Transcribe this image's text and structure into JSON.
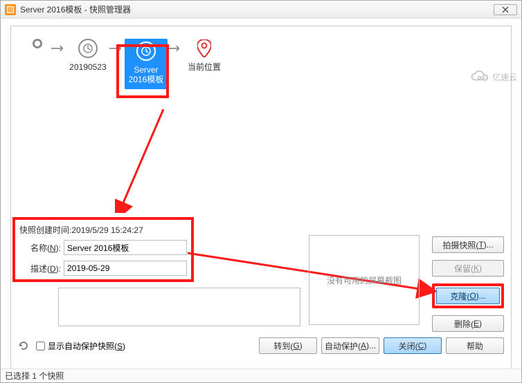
{
  "window": {
    "title": "Server 2016模板 - 快照管理器"
  },
  "timeline": {
    "nodes": [
      {
        "label": "20190523"
      },
      {
        "label": "Server 2016模板"
      },
      {
        "label": "当前位置"
      }
    ]
  },
  "details": {
    "created_label_prefix": "快照创建时间:",
    "created_value": "2019/5/29 15:24:27",
    "name_label": "名称(N):",
    "name_value": "Server 2016模板",
    "desc_label": "描述(D):",
    "desc_value": "2019-05-29"
  },
  "preview": {
    "placeholder": "没有可用的屏幕截图"
  },
  "buttons": {
    "take": "拍摄快照(T)...",
    "keep": "保留(K)",
    "clone": "克隆(O)...",
    "delete": "删除(E)"
  },
  "bottom": {
    "autoprotect_chk": "显示自动保护快照(S)",
    "goto": "转到(G)",
    "autoprotect_btn": "自动保护(A)...",
    "close": "关闭(C)",
    "help": "帮助"
  },
  "status": {
    "text": "已选择 1 个快照"
  },
  "watermark": {
    "text": "亿速云"
  }
}
